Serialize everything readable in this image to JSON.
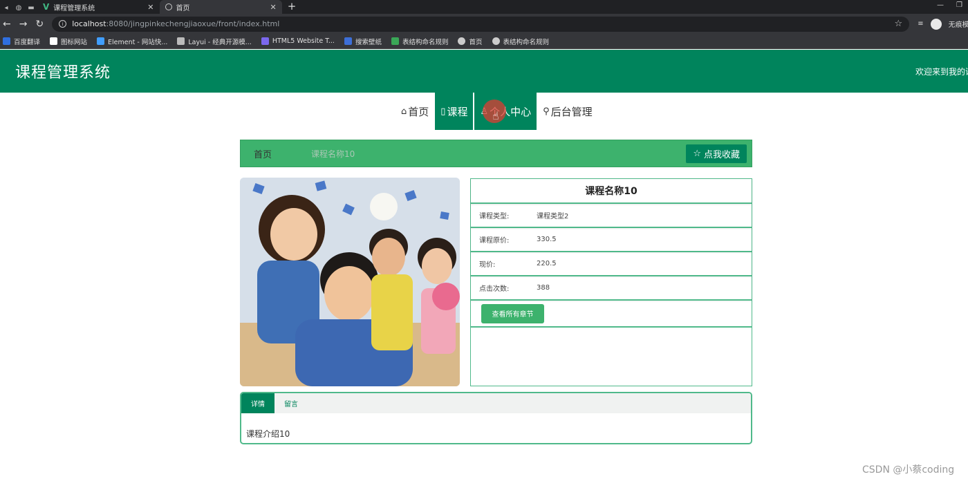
{
  "browser": {
    "tabs": [
      {
        "title": "课程管理系统",
        "icon": "vue-icon"
      },
      {
        "title": "首页",
        "icon": "globe-icon"
      }
    ],
    "url_host": "localhost",
    "url_path": ":8080/jingpinkechengjiaoxue/front/index.html",
    "profile_label": "无痕模式",
    "bookmarks": [
      {
        "label": "百度翻译",
        "color": "#2f6fe0"
      },
      {
        "label": "图标网站",
        "color": "#ffffff"
      },
      {
        "label": "Element - 网站快...",
        "color": "#409eff"
      },
      {
        "label": "Layui - 经典开源模...",
        "color": "#bbbbbb"
      },
      {
        "label": "HTML5 Website T...",
        "color": "#7b68ee"
      },
      {
        "label": "搜索壁纸",
        "color": "#3d6fd8"
      },
      {
        "label": "表结构命名规则",
        "color": "#3aa757"
      },
      {
        "label": "首页",
        "color": "#cccccc"
      },
      {
        "label": "表结构命名规则",
        "color": "#cccccc"
      }
    ]
  },
  "header": {
    "title": "课程管理系统",
    "welcome": "欢迎来到我的课程管理系统"
  },
  "nav": [
    {
      "label": "首页",
      "icon": "home-icon",
      "active": false
    },
    {
      "label": "课程",
      "icon": "book-icon",
      "active": true
    },
    {
      "label": "个人中心",
      "icon": "user-icon",
      "active": true
    },
    {
      "label": "后台管理",
      "icon": "link-icon",
      "active": false
    }
  ],
  "breadcrumb": {
    "home": "首页",
    "current": "课程名称10",
    "favorite_button": "点我收藏"
  },
  "course": {
    "name": "课程名称10",
    "rows": [
      {
        "label": "课程类型:",
        "value": "课程类型2"
      },
      {
        "label": "课程原价:",
        "value": "330.5"
      },
      {
        "label": "现价:",
        "value": "220.5"
      },
      {
        "label": "点击次数:",
        "value": "388"
      }
    ],
    "chapters_button": "查看所有章节",
    "image_alt": "children photo"
  },
  "tabs": {
    "items": [
      {
        "label": "详情",
        "active": true
      },
      {
        "label": "留言",
        "active": false
      }
    ],
    "content": "课程介绍10"
  },
  "colors": {
    "primary": "#00845c",
    "accent": "#3db26d",
    "border": "#4fb98a"
  },
  "watermark": "CSDN @小蔡coding"
}
